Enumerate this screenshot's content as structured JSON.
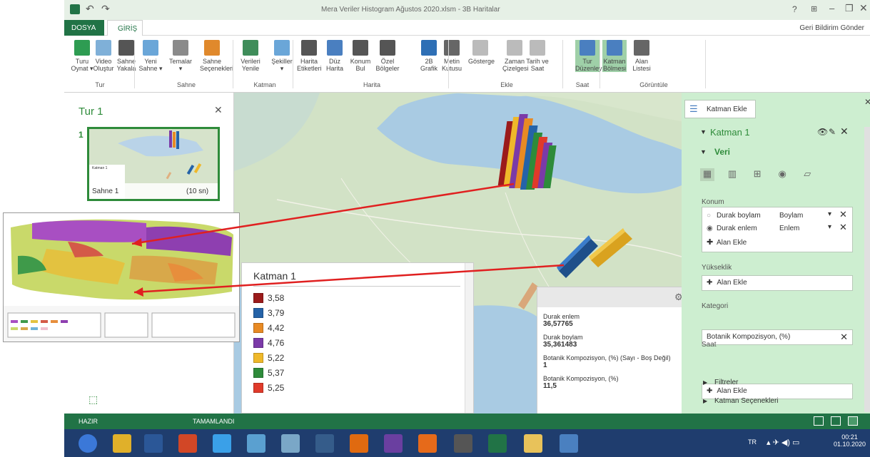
{
  "window": {
    "title": "Mera Veriler Histogram Ağustos 2020.xlsm - 3B Haritalar",
    "help": "?",
    "feedback": "Geri Bildirim Gönder"
  },
  "tabs": [
    "DOSYA",
    "GİRİŞ"
  ],
  "ribbon": {
    "buttons": [
      {
        "label": "Turu Oynat ▾",
        "color": "#2e9c52"
      },
      {
        "label": "Video Oluştur",
        "color": "#7fb0d8"
      },
      {
        "label": "Sahne Yakala",
        "color": "#555"
      },
      {
        "label": "Yeni Sahne ▾",
        "color": "#6aa6d8"
      },
      {
        "label": "Temalar ▾",
        "color": "#8a8a8a"
      },
      {
        "label": "Sahne Seçenekleri",
        "color": "#e0892c"
      },
      {
        "label": "Verileri Yenile",
        "color": "#3f8d5a"
      },
      {
        "label": "Şekiller ▾",
        "color": "#6aa6d8"
      },
      {
        "label": "Harita Etiketleri",
        "color": "#555"
      },
      {
        "label": "Düz Harita",
        "color": "#4a7fc0"
      },
      {
        "label": "Konum Bul",
        "color": "#555"
      },
      {
        "label": "Özel Bölgeler",
        "color": "#555"
      },
      {
        "label": "2B Grafik",
        "color": "#2e6fb5"
      },
      {
        "label": "Metin Kutusu",
        "color": "#666"
      },
      {
        "label": "Gösterge",
        "color": "#bbb"
      },
      {
        "label": "Zaman Çizelgesi",
        "color": "#bbb"
      },
      {
        "label": "Tarih ve Saat",
        "color": "#bbb"
      },
      {
        "label": "Tur Düzenleyicisi",
        "color": "#4a7fc0"
      },
      {
        "label": "Katman Bölmesi",
        "color": "#4a7fc0"
      },
      {
        "label": "Alan Listesi",
        "color": "#666"
      }
    ],
    "groups": [
      "Tur",
      "Sahne",
      "Katman",
      "Harita",
      "Ekle",
      "Saat",
      "Görüntüle"
    ]
  },
  "tour_pane": {
    "title": "Tur 1",
    "scene_number": "1",
    "scene_name": "Sahne 1",
    "scene_duration": "(10 sn)",
    "thumb_legend_title": "Katman 1"
  },
  "legend": {
    "title": "Katman 1",
    "items": [
      {
        "value": "3,58",
        "color": "#9b1b1b"
      },
      {
        "value": "3,79",
        "color": "#2563a8"
      },
      {
        "value": "4,42",
        "color": "#e88a24"
      },
      {
        "value": "4,76",
        "color": "#7b3aa8"
      },
      {
        "value": "5,22",
        "color": "#efb82a"
      },
      {
        "value": "5,37",
        "color": "#2e8b3a"
      },
      {
        "value": "5,25",
        "color": "#e03a2a"
      }
    ]
  },
  "tooltip": {
    "rows": [
      {
        "label": "Durak enlem",
        "value": "36,57765"
      },
      {
        "label": "Durak boylam",
        "value": "35,361483"
      },
      {
        "label": "Botanik Kompozisyon, (%) (Sayı - Boş Değil)",
        "value": "1"
      },
      {
        "label": "Botanik Kompozisyon, (%)",
        "value": "11,5"
      }
    ]
  },
  "layer_pane": {
    "add_layer": "Katman Ekle",
    "layer_name": "Katman 1",
    "data_section": "Veri",
    "location_label": "Konum",
    "location_rows": [
      {
        "field": "Durak boylam",
        "type": "Boylam"
      },
      {
        "field": "Durak enlem",
        "type": "Enlem"
      }
    ],
    "add_field": "Alan Ekle",
    "height_label": "Yükseklik",
    "category_label": "Kategori",
    "category_value": "Botanik Kompozisyon, (%)",
    "time_label": "Saat",
    "filters": "Filtreler",
    "layer_options": "Katman Seçenekleri"
  },
  "status": {
    "ready": "HAZIR",
    "done": "TAMAMLANDI"
  },
  "taskbar": {
    "lang": "TR",
    "time": "00:21",
    "date": "01.10.2020",
    "icons": [
      {
        "name": "windows-start",
        "color": "#3b78d8"
      },
      {
        "name": "chrome",
        "color": "#e0b02a"
      },
      {
        "name": "word",
        "color": "#2b5797"
      },
      {
        "name": "powerpoint",
        "color": "#d24726"
      },
      {
        "name": "ie",
        "color": "#3aa0e8"
      },
      {
        "name": "app",
        "color": "#5aa0d0"
      },
      {
        "name": "notepad",
        "color": "#7aa7c7"
      },
      {
        "name": "wa",
        "color": "#355c8a"
      },
      {
        "name": "media",
        "color": "#e06a10"
      },
      {
        "name": "vs",
        "color": "#6a3fa0"
      },
      {
        "name": "firefox",
        "color": "#e66a1a"
      },
      {
        "name": "calculator",
        "color": "#555"
      },
      {
        "name": "excel",
        "color": "#217346"
      },
      {
        "name": "explorer",
        "color": "#e8c25a"
      },
      {
        "name": "network",
        "color": "#4a80c0"
      }
    ]
  }
}
